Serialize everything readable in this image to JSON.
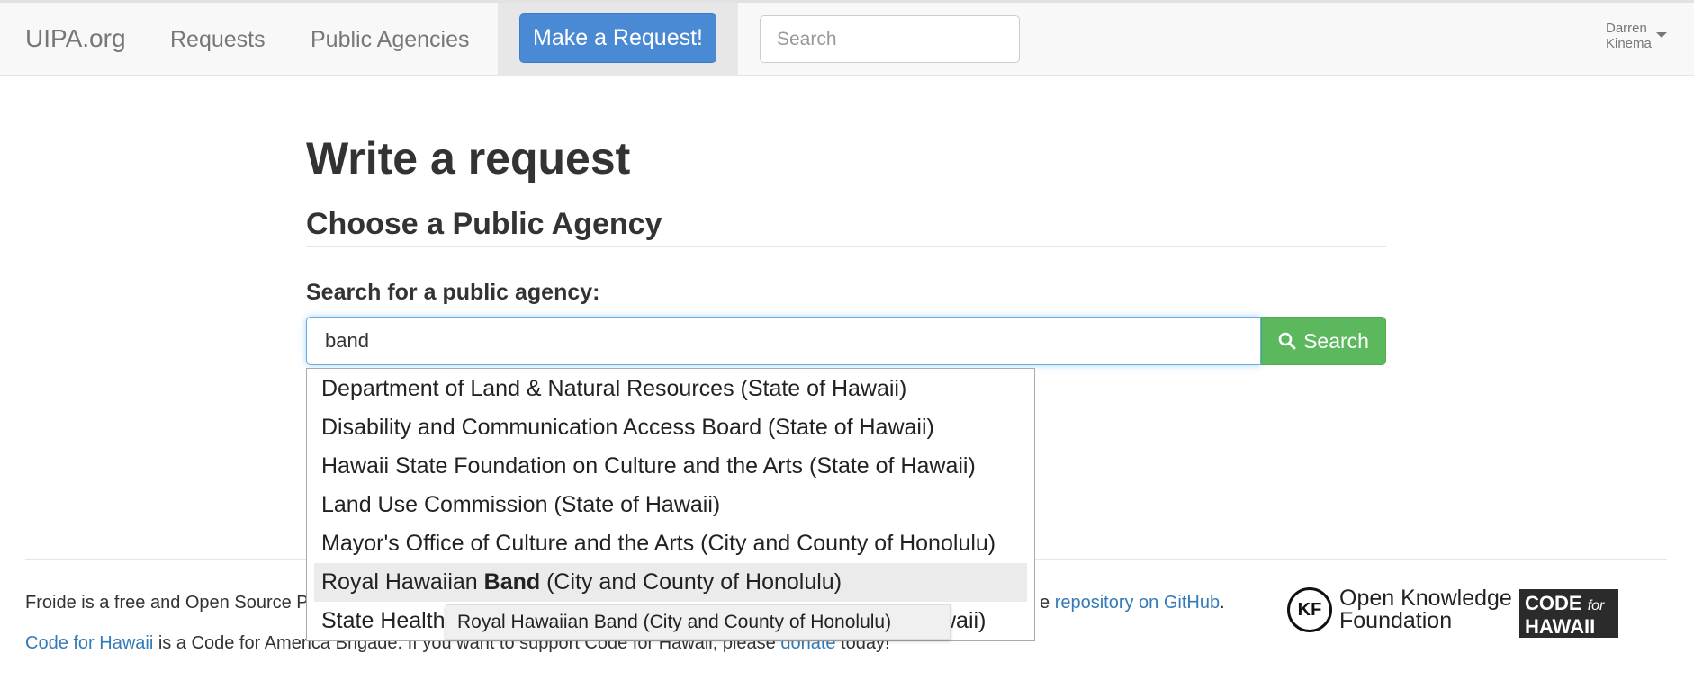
{
  "nav": {
    "brand": "UIPA.org",
    "requests": "Requests",
    "public_agencies": "Public Agencies",
    "make_request": "Make a Request!",
    "search_placeholder": "Search",
    "user_first": "Darren",
    "user_last": "Kinema"
  },
  "main": {
    "title": "Write a request",
    "section_title": "Choose a Public Agency",
    "search_label": "Search for a public agency:",
    "search_value": "band",
    "search_button": "Search"
  },
  "autocomplete": {
    "items": [
      {
        "before": "Department of Land & Natural Resources (State of Hawaii)",
        "match": "",
        "after": ""
      },
      {
        "before": "Disability and Communication Access Board (State of Hawaii)",
        "match": "",
        "after": ""
      },
      {
        "before": "Hawaii State Foundation on Culture and the Arts (State of Hawaii)",
        "match": "",
        "after": ""
      },
      {
        "before": "Land Use Commission (State of Hawaii)",
        "match": "",
        "after": ""
      },
      {
        "before": "Mayor's Office of Culture and the Arts (City and County of Honolulu)",
        "match": "",
        "after": ""
      },
      {
        "before": "Royal Hawaiian ",
        "match": "Band",
        "after": " (City and County of Honolulu)"
      },
      {
        "before": "State Health",
        "match": "",
        "after": ""
      }
    ],
    "partial_tail": "waii)",
    "active_index": 5,
    "tooltip": "Royal Hawaiian Band (City and County of Honolulu)"
  },
  "footer": {
    "line1_start": "Froide is a free and Open Source P",
    "line1_end_prefix": "e",
    "line1_link": "repository on GitHub",
    "line1_end": ".",
    "line2_link1": "Code for Hawaii",
    "line2_middle": " is a Code for America Brigade. If you want to support Code for Hawaii, please ",
    "line2_link2": "donate",
    "line2_end": " today!",
    "okf_line1": "Open Knowledge",
    "okf_line2": "Foundation",
    "okf_mark": "KF",
    "cfh_line1": "CODE",
    "cfh_for": "for",
    "cfh_line2": "HAWAII"
  }
}
